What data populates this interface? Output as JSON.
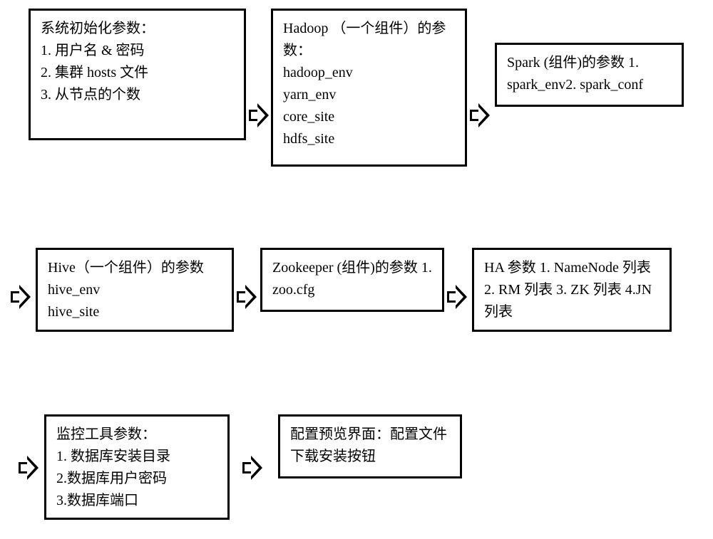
{
  "boxes": {
    "sysinit": {
      "title": "系统初始化参数：",
      "items": [
        "1. 用户名 & 密码",
        "2. 集群 hosts 文件",
        "3. 从节点的个数"
      ]
    },
    "hadoop": {
      "title": "Hadoop （一个组件）的参数：",
      "items": [
        "hadoop_env",
        "yarn_env",
        "core_site",
        "hdfs_site"
      ]
    },
    "spark": {
      "text": "Spark (组件)的参数 1. spark_env2. spark_conf"
    },
    "hive": {
      "title": "Hive（一个组件）的参数",
      "items": [
        "hive_env",
        "hive_site"
      ]
    },
    "zookeeper": {
      "text": "Zookeeper (组件)的参数 1. zoo.cfg"
    },
    "ha": {
      "text": "HA 参数 1. NameNode 列表 2. RM 列表 3. ZK 列表 4.JN 列表"
    },
    "monitor": {
      "title": "监控工具参数：",
      "items": [
        "1. 数据库安装目录",
        "2.数据库用户密码",
        "3.数据库端口"
      ]
    },
    "preview": {
      "text": "配置预览界面：配置文件下载安装按钮"
    }
  }
}
